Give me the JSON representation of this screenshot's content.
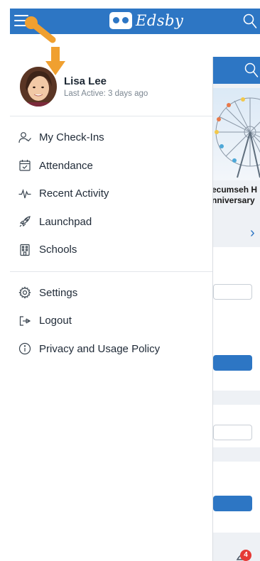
{
  "header": {
    "app_name": "Edsby"
  },
  "profile": {
    "name": "Lisa Lee",
    "last_active": "Last Active: 3 days ago"
  },
  "menu": {
    "primary": [
      {
        "label": "My Check-Ins",
        "icon": "person-check-icon"
      },
      {
        "label": "Attendance",
        "icon": "calendar-check-icon"
      },
      {
        "label": "Recent Activity",
        "icon": "pulse-icon"
      },
      {
        "label": "Launchpad",
        "icon": "rocket-icon"
      },
      {
        "label": "Schools",
        "icon": "building-icon"
      }
    ],
    "secondary": [
      {
        "label": "Settings",
        "icon": "gear-icon"
      },
      {
        "label": "Logout",
        "icon": "logout-icon"
      },
      {
        "label": "Privacy and Usage Policy",
        "icon": "info-icon"
      }
    ]
  },
  "background_page": {
    "caption_line1": "ecumseh H",
    "caption_line2": "nniversary",
    "notification_count": "4"
  },
  "colors": {
    "brand_blue": "#2d76c4",
    "annotation_orange": "#f0a030",
    "badge_red": "#e53935"
  }
}
